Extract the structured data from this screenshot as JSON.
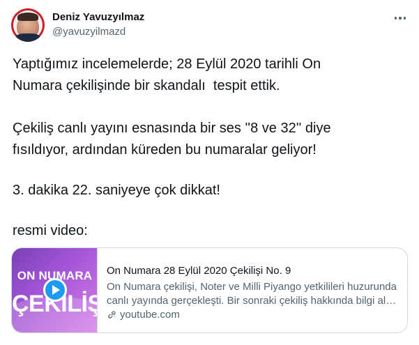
{
  "author": {
    "display_name": "Deniz Yavuzyılmaz",
    "handle": "@yavuzyilmazd",
    "avatar_icon": "profile-photo"
  },
  "more_icon": "more-horizontal-icon",
  "tweet": {
    "paragraph1": [
      "Yaptığımız incelemelerde; 28 Eylül 2020 tarihli On",
      "Numara çekilişinde bir skandalı  tespit ettik."
    ],
    "paragraph2": [
      "Çekiliş canlı yayını esnasında bir ses ''8 ve 32'' diye",
      "fısıldıyor, ardından küreden bu numaralar geliyor!"
    ],
    "paragraph3": [
      "3. dakika 22. saniyeye çok dikkat!"
    ],
    "paragraph4": [
      "resmi video:"
    ]
  },
  "card": {
    "thumbnail_top": "ON NUMARA",
    "thumbnail_bottom": "ÇEKİLİŞİ",
    "play_icon": "play-icon",
    "title": "On Numara 28 Eylül 2020 Çekilişi No. 9",
    "description": [
      "On Numara çekilişi, Noter ve Milli Piyango yetkilileri huzurunda",
      "canlı yayında gerçekleşti. Bir sonraki çekiliş hakkında bilgi alm..."
    ],
    "domain": "youtube.com",
    "link_icon": "link-icon"
  },
  "colors": {
    "text": "#0f1419",
    "secondary": "#536471",
    "border": "#cfd9de",
    "play": "#1d9bf0",
    "thumbnail": "#a657d8"
  }
}
